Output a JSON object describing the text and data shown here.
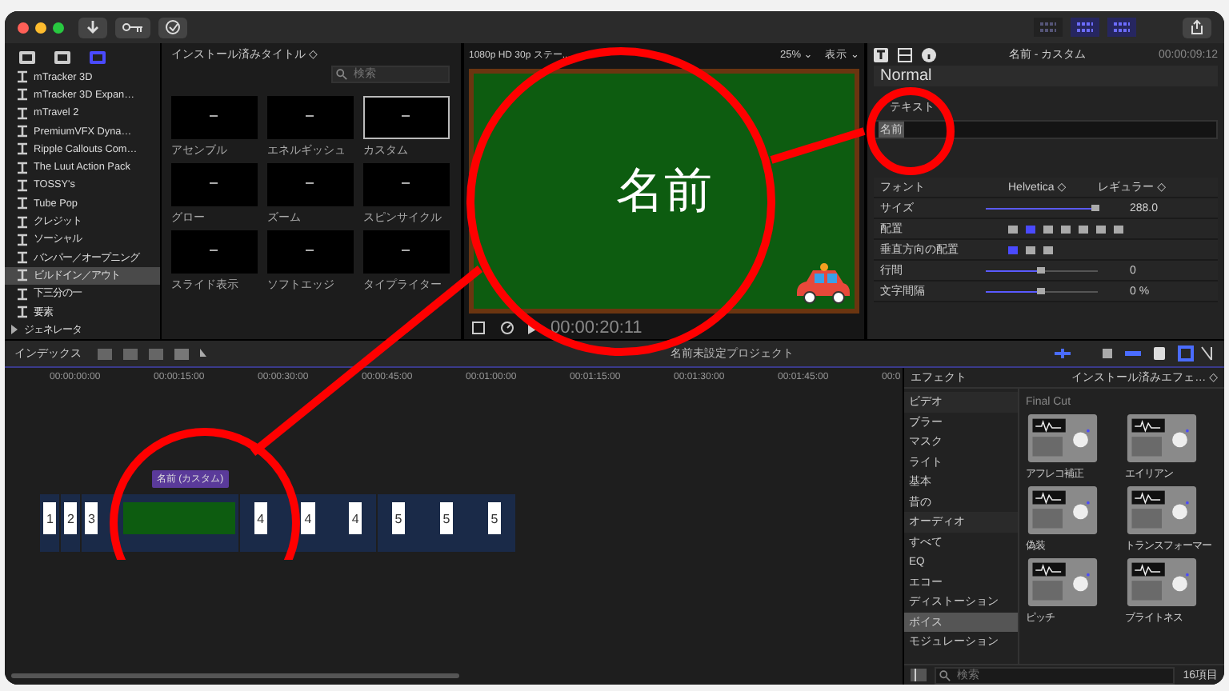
{
  "toolbar": {
    "layout_toggles": [
      {
        "selected": false
      },
      {
        "selected": true
      },
      {
        "selected": true
      }
    ]
  },
  "sidebar": {
    "tabs": [
      {
        "selected": false
      },
      {
        "selected": false
      },
      {
        "selected": true
      }
    ],
    "items": [
      {
        "label": "mTracker 3D",
        "selected": false
      },
      {
        "label": "mTracker 3D Expan…",
        "selected": false
      },
      {
        "label": "mTravel 2",
        "selected": false
      },
      {
        "label": "PremiumVFX Dyna…",
        "selected": false
      },
      {
        "label": "Ripple Callouts Com…",
        "selected": false
      },
      {
        "label": "The Luut Action Pack",
        "selected": false
      },
      {
        "label": "TOSSY's",
        "selected": false
      },
      {
        "label": "Tube Pop",
        "selected": false
      },
      {
        "label": "クレジット",
        "selected": false
      },
      {
        "label": "ソーシャル",
        "selected": false
      },
      {
        "label": "バンパー／オープニング",
        "selected": false
      },
      {
        "label": "ビルドイン／アウト",
        "selected": true
      },
      {
        "label": "下三分の一",
        "selected": false
      },
      {
        "label": "要素",
        "selected": false
      }
    ],
    "category": {
      "label": "ジェネレータ",
      "expanded": false
    }
  },
  "browser": {
    "title": "インストール済みタイトル ◇",
    "search": {
      "placeholder": "検索"
    },
    "tiles": [
      {
        "label": "アセンブル",
        "selected": false
      },
      {
        "label": "エネルギッシュ",
        "selected": false
      },
      {
        "label": "カスタム",
        "selected": true
      },
      {
        "label": "グロー",
        "selected": false
      },
      {
        "label": "ズーム",
        "selected": false
      },
      {
        "label": "スピンサイクル",
        "selected": false
      },
      {
        "label": "スライド表示",
        "selected": false
      },
      {
        "label": "ソフトエッジ",
        "selected": false
      },
      {
        "label": "タイプライター",
        "selected": false
      }
    ]
  },
  "viewer": {
    "format": "1080p HD 30p ステー...",
    "zoom": "25% ⌄",
    "view": "表示 ⌄",
    "title_text": "名前",
    "timecode": "00:00:20:11"
  },
  "inspector": {
    "title": "名前 - カスタム",
    "timecode": "00:00:09:12",
    "preset": "Normal",
    "section": "テキスト",
    "text": "名前",
    "rows": [
      {
        "kind": "popup",
        "label": "フォント",
        "values": [
          "Helvetica ◇",
          "レギュラー ◇"
        ]
      },
      {
        "kind": "slider",
        "label": "サイズ",
        "level": 0.98,
        "value": "288.0"
      },
      {
        "kind": "buttons",
        "label": "配置",
        "options": [
          {
            "selected": false
          },
          {
            "selected": true
          },
          {
            "selected": false
          },
          {
            "selected": false
          },
          {
            "selected": false
          },
          {
            "selected": false
          },
          {
            "selected": false
          }
        ]
      },
      {
        "kind": "buttons",
        "label": "垂直方向の配置",
        "options": [
          {
            "selected": true
          },
          {
            "selected": false
          },
          {
            "selected": false
          }
        ]
      },
      {
        "kind": "slider",
        "label": "行間",
        "level": 0.5,
        "value": "0"
      },
      {
        "kind": "slider",
        "label": "文字間隔",
        "level": 0.5,
        "value": "0 %"
      }
    ]
  },
  "timeline": {
    "index_label": "インデックス",
    "project": "名前未設定プロジェクト",
    "ruler": [
      "00:00:00:00",
      "00:00:15:00",
      "00:00:30:00",
      "00:00:45:00",
      "00:01:00:00",
      "00:01:15:00",
      "00:01:30:00",
      "00:01:45:00",
      "00:0"
    ],
    "title_clip": "名前 (カスタム)",
    "clips": [
      {
        "numbers": [
          "1"
        ]
      },
      {
        "numbers": [
          "2"
        ]
      },
      {
        "numbers": [
          "3"
        ]
      },
      {
        "numbers": [
          "4",
          "4",
          "4"
        ]
      },
      {
        "numbers": [
          "5",
          "5",
          "5"
        ]
      }
    ]
  },
  "effects": {
    "title": "エフェクト",
    "source": "インストール済みエフェ… ◇",
    "categories": [
      {
        "label": "ビデオ",
        "kind": "group",
        "selected": false
      },
      {
        "label": "ブラー",
        "kind": "item",
        "selected": false
      },
      {
        "label": "マスク",
        "kind": "item",
        "selected": false
      },
      {
        "label": "ライト",
        "kind": "item",
        "selected": false
      },
      {
        "label": "基本",
        "kind": "item",
        "selected": false
      },
      {
        "label": "昔の",
        "kind": "item",
        "selected": false
      },
      {
        "label": "オーディオ",
        "kind": "group",
        "selected": false
      },
      {
        "label": "すべて",
        "kind": "item",
        "selected": false
      },
      {
        "label": "EQ",
        "kind": "item",
        "selected": false
      },
      {
        "label": "エコー",
        "kind": "item",
        "selected": false
      },
      {
        "label": "ディストーション",
        "kind": "item",
        "selected": false
      },
      {
        "label": "ボイス",
        "kind": "item",
        "selected": true
      },
      {
        "label": "モジュレーション",
        "kind": "item",
        "selected": false
      }
    ],
    "group": "Final Cut",
    "items": [
      {
        "label": "アフレコ補正"
      },
      {
        "label": "エイリアン"
      },
      {
        "label": "偽装"
      },
      {
        "label": "トランスフォーマー"
      },
      {
        "label": "ピッチ"
      },
      {
        "label": "ブライトネス"
      }
    ],
    "search": {
      "placeholder": "検索"
    },
    "count": "16項目"
  }
}
